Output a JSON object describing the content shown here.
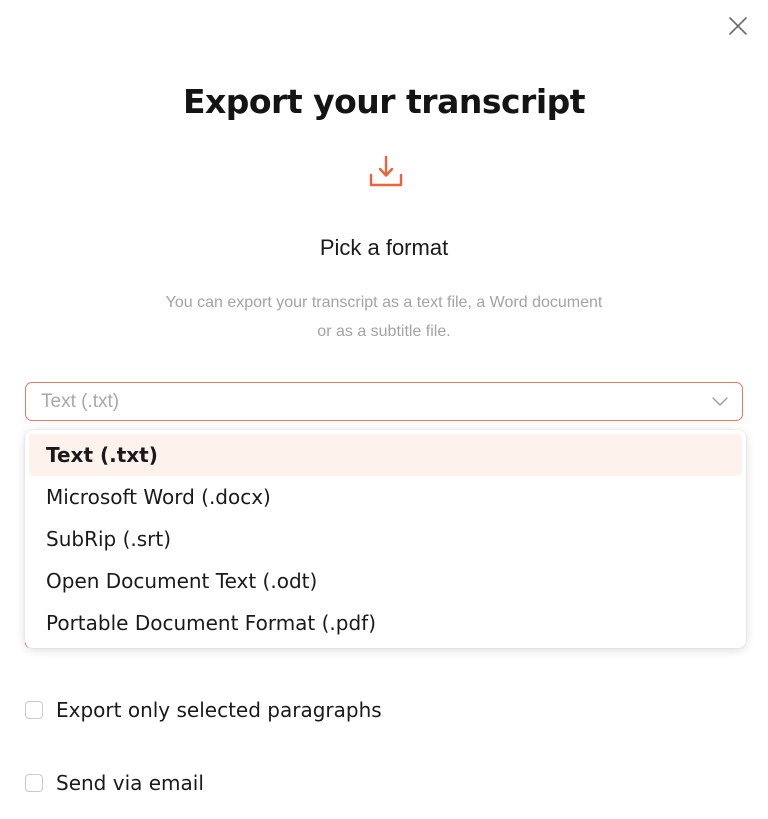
{
  "dialog": {
    "title": "Export your transcript",
    "icon": "download-icon",
    "subtitle": "Pick a format",
    "description_line1": "You can export your transcript as a text file, a Word document",
    "description_line2": "or as a subtitle file.",
    "close_icon": "close-icon"
  },
  "format_select": {
    "value": "Text (.txt)",
    "chevron_icon": "chevron-down-icon",
    "options": [
      {
        "label": "Text (.txt)",
        "selected": true
      },
      {
        "label": "Microsoft Word (.docx)",
        "selected": false
      },
      {
        "label": "SubRip (.srt)",
        "selected": false
      },
      {
        "label": "Open Document Text (.odt)",
        "selected": false
      },
      {
        "label": "Portable Document Format (.pdf)",
        "selected": false
      }
    ]
  },
  "options": {
    "selected_paragraphs_label": "Export only selected paragraphs",
    "selected_paragraphs_checked": false,
    "send_email_label": "Send via email",
    "send_email_checked": false
  },
  "colors": {
    "accent": "#e8653a",
    "border_focus": "#e8795a",
    "selected_option_bg": "#fdf2ec",
    "muted_text": "#a3a3a3"
  }
}
